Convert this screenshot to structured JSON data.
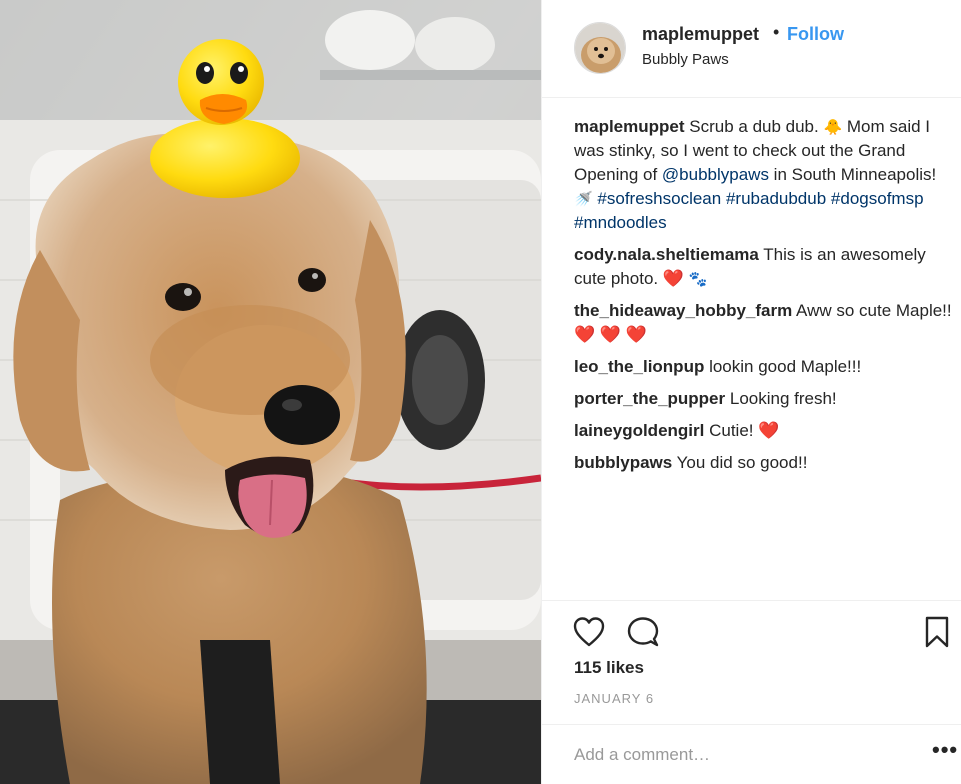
{
  "header": {
    "username": "maplemuppet",
    "separator": "•",
    "follow_label": "Follow",
    "location": "Bubbly Paws"
  },
  "caption": {
    "username": "maplemuppet",
    "text_1": " Scrub a dub dub. ",
    "text_2": " Mom said I was stinky, so I went to check out the Grand Opening of ",
    "mention": "@bubblypaws",
    "text_3": " in South Minneapolis! ",
    "hashtags": [
      "#sofreshsoclean",
      "#rubadubdub",
      "#dogsofmsp",
      "#mndoodles"
    ]
  },
  "comments": [
    {
      "username": "cody.nala.sheltiemama",
      "text": " This is an awesomely cute photo. ",
      "suffix": "❤️",
      "suffix2": "🐾"
    },
    {
      "username": "the_hideaway_hobby_farm",
      "text": " Aww so cute Maple!! ",
      "suffix": "❤️ ❤️ ❤️"
    },
    {
      "username": "leo_the_lionpup",
      "text": " lookin good Maple!!!"
    },
    {
      "username": "porter_the_pupper",
      "text": " Looking fresh!"
    },
    {
      "username": "laineygoldengirl",
      "text": " Cutie! ",
      "suffix": "❤️"
    },
    {
      "username": "bubblypaws",
      "text": " You did so good!!"
    }
  ],
  "actions": {
    "like_icon": "heart-outline-icon",
    "comment_icon": "speech-bubble-icon",
    "save_icon": "bookmark-icon"
  },
  "likes": "115 likes",
  "date": "JANUARY 6",
  "add_comment": {
    "placeholder": "Add a comment…",
    "more_label": "•••"
  },
  "colors": {
    "link": "#003569",
    "follow": "#3897f0",
    "heart": "#ed2b3c",
    "muted": "#999999",
    "text": "#262626",
    "duck": "#ffd600"
  }
}
